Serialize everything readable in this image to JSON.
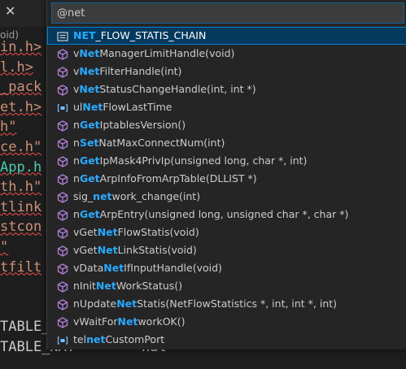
{
  "editor": {
    "tab_close": "✕",
    "breadcrumb": "oid)",
    "lines": [
      {
        "text": "in.h>",
        "cls": "squig"
      },
      {
        "text": "l.h>",
        "cls": "squig"
      },
      {
        "text": "_pack",
        "cls": "squig"
      },
      {
        "text": "et.h>",
        "cls": "squig"
      },
      {
        "text": "h\"",
        "cls": "squig"
      },
      {
        "text": "ce.h\"",
        "cls": "squig"
      },
      {
        "text": "App.h",
        "cls": "squig green"
      },
      {
        "text": "th.h\"",
        "cls": "squig"
      },
      {
        "text": "tlink",
        "cls": "squig"
      },
      {
        "text": "stcon",
        "cls": "squig"
      },
      {
        "text": "\"",
        "cls": "squig"
      },
      {
        "text": "tfilt",
        "cls": "squig"
      },
      {
        "text": "",
        "cls": ""
      },
      {
        "text": "",
        "cls": ""
      },
      {
        "text": "TABLE_",
        "cls": "plain"
      },
      {
        "text": "TABLE_NAT        nat",
        "cls": "plain"
      }
    ]
  },
  "quick_open": {
    "query": "@net",
    "placeholder": "",
    "items": [
      {
        "icon": "struct-icon",
        "pre": "",
        "hl": "NET",
        "post": "_FLOW_STATIS_CHAIN",
        "selected": true
      },
      {
        "icon": "method-icon",
        "pre": "v",
        "hl": "Net",
        "post": "ManagerLimitHandle(void)"
      },
      {
        "icon": "method-icon",
        "pre": "v",
        "hl": "Net",
        "post": "FilterHandle(int)"
      },
      {
        "icon": "method-icon",
        "pre": "v",
        "hl": "Net",
        "post": "StatusChangeHandle(int, int *)"
      },
      {
        "icon": "variable-icon",
        "pre": "ul",
        "hl": "Net",
        "post": "FlowLastTime"
      },
      {
        "icon": "method-icon",
        "pre": "n",
        "hl": "Get",
        "post": "IptablesVersion()"
      },
      {
        "icon": "method-icon",
        "pre": "n",
        "hl": "Set",
        "post": "NatMaxConnectNum(int)"
      },
      {
        "icon": "method-icon",
        "pre": "n",
        "hl": "Get",
        "post": "IpMask4PrivIp(unsigned long, char *, int)"
      },
      {
        "icon": "method-icon",
        "pre": "n",
        "hl": "Get",
        "post": "ArpInfoFromArpTable(DLLIST *)"
      },
      {
        "icon": "method-icon",
        "pre": "sig_",
        "hl": "net",
        "post": "work_change(int)"
      },
      {
        "icon": "method-icon",
        "pre": "n",
        "hl": "Get",
        "post": "ArpEntry(unsigned long, unsigned char *, char *)"
      },
      {
        "icon": "method-icon",
        "pre": "vGet",
        "hl": "Net",
        "post": "FlowStatis(void)"
      },
      {
        "icon": "method-icon",
        "pre": "vGet",
        "hl": "Net",
        "post": "LinkStatis(void)"
      },
      {
        "icon": "method-icon",
        "pre": "vData",
        "hl": "Net",
        "post": "IfInputHandle(void)"
      },
      {
        "icon": "method-icon",
        "pre": "nInit",
        "hl": "Net",
        "post": "WorkStatus()"
      },
      {
        "icon": "method-icon",
        "pre": "nUpdate",
        "hl": "Net",
        "post": "Statis(NetFlowStatistics *, int, int *, int)"
      },
      {
        "icon": "method-icon",
        "pre": "vWaitFor",
        "hl": "Net",
        "post": "workOK()"
      },
      {
        "icon": "variable-icon",
        "pre": "tel",
        "hl": "net",
        "post": "CustomPort"
      }
    ]
  },
  "colors": {
    "highlight": "#2aaaff",
    "method_icon": "#b180d7",
    "variable_icon": "#75beff",
    "selection_bg": "#04395e"
  }
}
